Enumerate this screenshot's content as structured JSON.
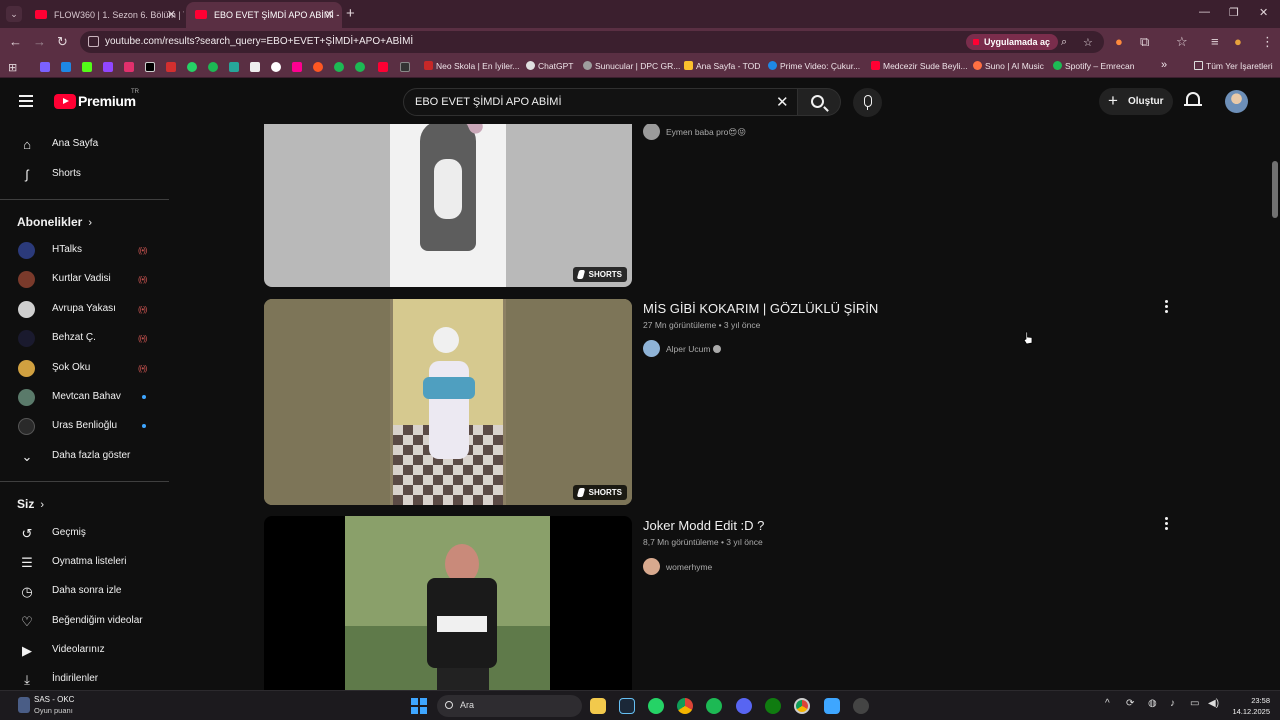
{
  "browser": {
    "tabs": [
      {
        "title": "FLOW360 | 1. Sezon 6. Bölüm | T",
        "active": false
      },
      {
        "title": "EBO EVET ŞİMDİ APO ABİMİ - Y",
        "active": true
      }
    ],
    "url": "youtube.com/results?search_query=EBO+EVET+ŞİMDİ+APO+ABİMİ",
    "open_in_app": "Uygulamada aç",
    "bookmarks": [
      "Neo Skola | En İyiler...",
      "ChatGPT",
      "Sunucular | DPC GR...",
      "Ana Sayfa - TOD",
      "Prime Video: Çukur...",
      "Medcezir Sude Beyli...",
      "Suno | AI Music",
      "Spotify – Emrecan"
    ],
    "all_bookmarks": "Tüm Yer İşaretleri"
  },
  "header": {
    "logo": "Premium",
    "region": "TR",
    "search_query": "EBO EVET ŞİMDİ APO ABİMİ",
    "create_label": "Oluştur"
  },
  "sidebar": {
    "main": [
      {
        "label": "Ana Sayfa",
        "icon": "home-icon"
      },
      {
        "label": "Shorts",
        "icon": "shorts-icon"
      }
    ],
    "subscriptions_title": "Abonelikler",
    "subscriptions": [
      {
        "name": "HTalks",
        "status": "live",
        "color": "#2b3a7a"
      },
      {
        "name": "Kurtlar Vadisi",
        "status": "live",
        "color": "#7a3a2b"
      },
      {
        "name": "Avrupa Yakası",
        "status": "live",
        "color": "#cfcfcf"
      },
      {
        "name": "Behzat Ç.",
        "status": "live",
        "color": "#1a1a2e"
      },
      {
        "name": "Şok Oku",
        "status": "live",
        "color": "#d0a040"
      },
      {
        "name": "Mevtcan Bahav",
        "status": "new",
        "color": "#5a7a6a"
      },
      {
        "name": "Uras Benlioğlu",
        "status": "new",
        "color": "#2a2a2a"
      }
    ],
    "show_more": "Daha fazla göster",
    "you_title": "Siz",
    "you": [
      {
        "label": "Geçmiş",
        "icon": "history-icon"
      },
      {
        "label": "Oynatma listeleri",
        "icon": "playlist-icon"
      },
      {
        "label": "Daha sonra izle",
        "icon": "watch-later-icon"
      },
      {
        "label": "Beğendiğim videolar",
        "icon": "like-icon"
      },
      {
        "label": "Videolarınız",
        "icon": "your-videos-icon"
      },
      {
        "label": "İndirilenler",
        "icon": "download-icon"
      }
    ]
  },
  "results": [
    {
      "title": "",
      "meta": "",
      "channel": "Eymen baba pro😍😝",
      "badge": "SHORTS"
    },
    {
      "title": "MİS GİBİ KOKARIM | GÖZLÜKLÜ ŞİRİN",
      "meta": "27 Mn görüntüleme • 3 yıl önce",
      "channel": "Alper Ucum",
      "badge": "SHORTS"
    },
    {
      "title": "Joker Modd Edit :D ?",
      "meta": "8,7 Mn görüntüleme • 3 yıl önce",
      "channel": "womerhyme",
      "badge": ""
    }
  ],
  "taskbar": {
    "widget_title": "SAS - OKC",
    "widget_sub": "Oyun puanı",
    "search_placeholder": "Ara",
    "time": "23:58",
    "date": "14.12.2025"
  }
}
